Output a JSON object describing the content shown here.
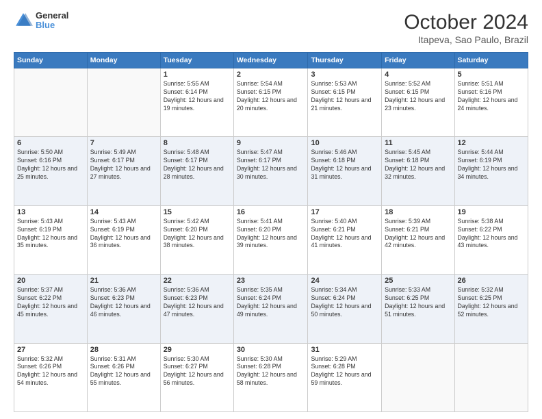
{
  "header": {
    "logo_general": "General",
    "logo_blue": "Blue",
    "month_year": "October 2024",
    "location": "Itapeva, Sao Paulo, Brazil"
  },
  "days_of_week": [
    "Sunday",
    "Monday",
    "Tuesday",
    "Wednesday",
    "Thursday",
    "Friday",
    "Saturday"
  ],
  "weeks": [
    [
      {
        "day": "",
        "info": ""
      },
      {
        "day": "",
        "info": ""
      },
      {
        "day": "1",
        "info": "Sunrise: 5:55 AM\nSunset: 6:14 PM\nDaylight: 12 hours and 19 minutes."
      },
      {
        "day": "2",
        "info": "Sunrise: 5:54 AM\nSunset: 6:15 PM\nDaylight: 12 hours and 20 minutes."
      },
      {
        "day": "3",
        "info": "Sunrise: 5:53 AM\nSunset: 6:15 PM\nDaylight: 12 hours and 21 minutes."
      },
      {
        "day": "4",
        "info": "Sunrise: 5:52 AM\nSunset: 6:15 PM\nDaylight: 12 hours and 23 minutes."
      },
      {
        "day": "5",
        "info": "Sunrise: 5:51 AM\nSunset: 6:16 PM\nDaylight: 12 hours and 24 minutes."
      }
    ],
    [
      {
        "day": "6",
        "info": "Sunrise: 5:50 AM\nSunset: 6:16 PM\nDaylight: 12 hours and 25 minutes."
      },
      {
        "day": "7",
        "info": "Sunrise: 5:49 AM\nSunset: 6:17 PM\nDaylight: 12 hours and 27 minutes."
      },
      {
        "day": "8",
        "info": "Sunrise: 5:48 AM\nSunset: 6:17 PM\nDaylight: 12 hours and 28 minutes."
      },
      {
        "day": "9",
        "info": "Sunrise: 5:47 AM\nSunset: 6:17 PM\nDaylight: 12 hours and 30 minutes."
      },
      {
        "day": "10",
        "info": "Sunrise: 5:46 AM\nSunset: 6:18 PM\nDaylight: 12 hours and 31 minutes."
      },
      {
        "day": "11",
        "info": "Sunrise: 5:45 AM\nSunset: 6:18 PM\nDaylight: 12 hours and 32 minutes."
      },
      {
        "day": "12",
        "info": "Sunrise: 5:44 AM\nSunset: 6:19 PM\nDaylight: 12 hours and 34 minutes."
      }
    ],
    [
      {
        "day": "13",
        "info": "Sunrise: 5:43 AM\nSunset: 6:19 PM\nDaylight: 12 hours and 35 minutes."
      },
      {
        "day": "14",
        "info": "Sunrise: 5:43 AM\nSunset: 6:19 PM\nDaylight: 12 hours and 36 minutes."
      },
      {
        "day": "15",
        "info": "Sunrise: 5:42 AM\nSunset: 6:20 PM\nDaylight: 12 hours and 38 minutes."
      },
      {
        "day": "16",
        "info": "Sunrise: 5:41 AM\nSunset: 6:20 PM\nDaylight: 12 hours and 39 minutes."
      },
      {
        "day": "17",
        "info": "Sunrise: 5:40 AM\nSunset: 6:21 PM\nDaylight: 12 hours and 41 minutes."
      },
      {
        "day": "18",
        "info": "Sunrise: 5:39 AM\nSunset: 6:21 PM\nDaylight: 12 hours and 42 minutes."
      },
      {
        "day": "19",
        "info": "Sunrise: 5:38 AM\nSunset: 6:22 PM\nDaylight: 12 hours and 43 minutes."
      }
    ],
    [
      {
        "day": "20",
        "info": "Sunrise: 5:37 AM\nSunset: 6:22 PM\nDaylight: 12 hours and 45 minutes."
      },
      {
        "day": "21",
        "info": "Sunrise: 5:36 AM\nSunset: 6:23 PM\nDaylight: 12 hours and 46 minutes."
      },
      {
        "day": "22",
        "info": "Sunrise: 5:36 AM\nSunset: 6:23 PM\nDaylight: 12 hours and 47 minutes."
      },
      {
        "day": "23",
        "info": "Sunrise: 5:35 AM\nSunset: 6:24 PM\nDaylight: 12 hours and 49 minutes."
      },
      {
        "day": "24",
        "info": "Sunrise: 5:34 AM\nSunset: 6:24 PM\nDaylight: 12 hours and 50 minutes."
      },
      {
        "day": "25",
        "info": "Sunrise: 5:33 AM\nSunset: 6:25 PM\nDaylight: 12 hours and 51 minutes."
      },
      {
        "day": "26",
        "info": "Sunrise: 5:32 AM\nSunset: 6:25 PM\nDaylight: 12 hours and 52 minutes."
      }
    ],
    [
      {
        "day": "27",
        "info": "Sunrise: 5:32 AM\nSunset: 6:26 PM\nDaylight: 12 hours and 54 minutes."
      },
      {
        "day": "28",
        "info": "Sunrise: 5:31 AM\nSunset: 6:26 PM\nDaylight: 12 hours and 55 minutes."
      },
      {
        "day": "29",
        "info": "Sunrise: 5:30 AM\nSunset: 6:27 PM\nDaylight: 12 hours and 56 minutes."
      },
      {
        "day": "30",
        "info": "Sunrise: 5:30 AM\nSunset: 6:28 PM\nDaylight: 12 hours and 58 minutes."
      },
      {
        "day": "31",
        "info": "Sunrise: 5:29 AM\nSunset: 6:28 PM\nDaylight: 12 hours and 59 minutes."
      },
      {
        "day": "",
        "info": ""
      },
      {
        "day": "",
        "info": ""
      }
    ]
  ]
}
